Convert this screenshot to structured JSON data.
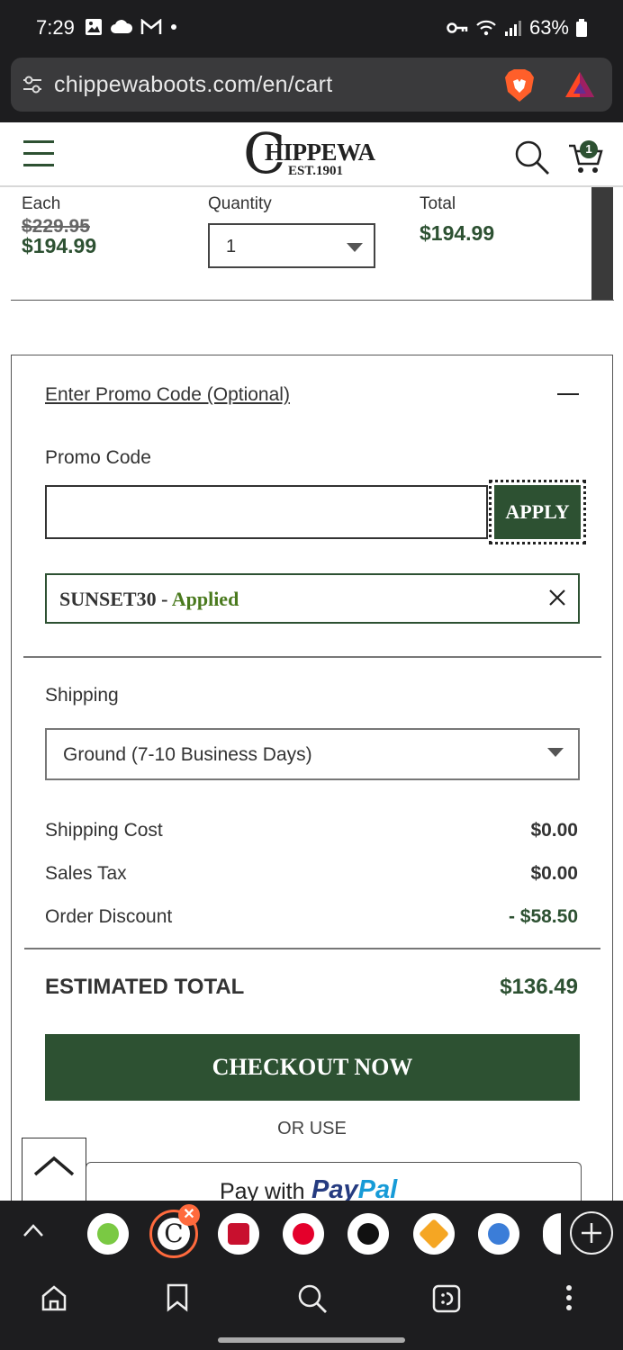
{
  "status_bar": {
    "time": "7:29",
    "battery": "63%"
  },
  "browser": {
    "url": "chippewaboots.com/en/cart"
  },
  "header": {
    "logo_text": "HIPPEWA",
    "logo_est": "EST.1901",
    "cart_count": "1"
  },
  "line_item": {
    "each_label": "Each",
    "original_price": "$229.95",
    "sale_price": "$194.99",
    "quantity_label": "Quantity",
    "quantity_value": "1",
    "total_label": "Total",
    "total_value": "$194.99"
  },
  "promo": {
    "toggle_label": "Enter Promo Code (Optional)",
    "field_label": "Promo Code",
    "input_value": "",
    "apply_label": "APPLY",
    "applied_code": "SUNSET30",
    "applied_separator": " - ",
    "applied_status": "Applied"
  },
  "shipping": {
    "label": "Shipping",
    "selected": "Ground (7-10 Business Days)"
  },
  "summary": {
    "rows": [
      {
        "label": "Shipping Cost",
        "value": "$0.00"
      },
      {
        "label": "Sales Tax",
        "value": "$0.00"
      },
      {
        "label": "Order Discount",
        "value": "- $58.50"
      }
    ],
    "estimated_label": "ESTIMATED TOTAL",
    "estimated_value": "$136.49",
    "checkout_label": "CHECKOUT NOW",
    "or_use": "OR USE",
    "paypal_prefix": "Pay with",
    "paypal_brand_1": "Pay",
    "paypal_brand_2": "Pal"
  },
  "tab_strip": {
    "active_tab_letter": "C",
    "close_glyph": "✕"
  },
  "colors": {
    "brand_green": "#2d5132",
    "applied_green": "#4a7a1e",
    "tab_accent": "#ff6a3d",
    "browser_dark": "#1d1d1f"
  }
}
